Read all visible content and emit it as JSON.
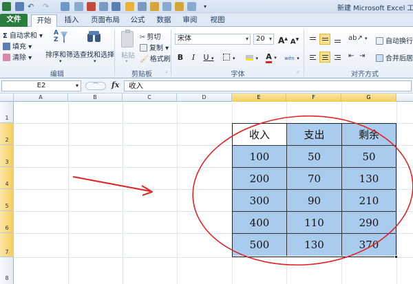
{
  "window": {
    "title": "新建 Microsoft Excel 工作"
  },
  "tabs": [
    "文件",
    "开始",
    "插入",
    "页面布局",
    "公式",
    "数据",
    "审阅",
    "视图"
  ],
  "ribbon": {
    "editing": {
      "autosum": "自动求和",
      "fill": "填充",
      "clear": "清除",
      "sort_filter": "排序和筛选",
      "find_select": "查找和选择",
      "group_label": "编辑"
    },
    "clipboard": {
      "paste": "粘贴",
      "cut": "剪切",
      "copy": "复制",
      "format_painter": "格式刷",
      "group_label": "剪贴板"
    },
    "font": {
      "font_name": "宋体",
      "font_size": "20",
      "grow": "A",
      "shrink": "A",
      "bold": "B",
      "italic": "I",
      "underline": "U",
      "font_color_label": "A",
      "phonetic": "wén",
      "group_label": "字体"
    },
    "alignment": {
      "wrap_text": "自动换行",
      "merge_center": "合并后居中",
      "group_label": "对齐方式"
    }
  },
  "formula_bar": {
    "name_box": "E2",
    "fx": "fx",
    "content": "收入"
  },
  "columns": [
    "A",
    "B",
    "C",
    "D",
    "E",
    "F",
    "G"
  ],
  "selected_columns": [
    "E",
    "F",
    "G"
  ],
  "rows": [
    "1",
    "2",
    "3",
    "4",
    "5",
    "6",
    "7",
    "8"
  ],
  "selected_rows": [
    "2",
    "3",
    "4",
    "5",
    "6",
    "7"
  ],
  "table": {
    "headers": [
      "收入",
      "支出",
      "剩余"
    ],
    "rows": [
      [
        "100",
        "50",
        "50"
      ],
      [
        "200",
        "70",
        "130"
      ],
      [
        "300",
        "90",
        "210"
      ],
      [
        "400",
        "110",
        "290"
      ],
      [
        "500",
        "130",
        "370"
      ]
    ]
  },
  "colors": {
    "selection_fill": "#a8cbee",
    "annotation": "#e02424",
    "file_tab": "#2a7d3c"
  }
}
